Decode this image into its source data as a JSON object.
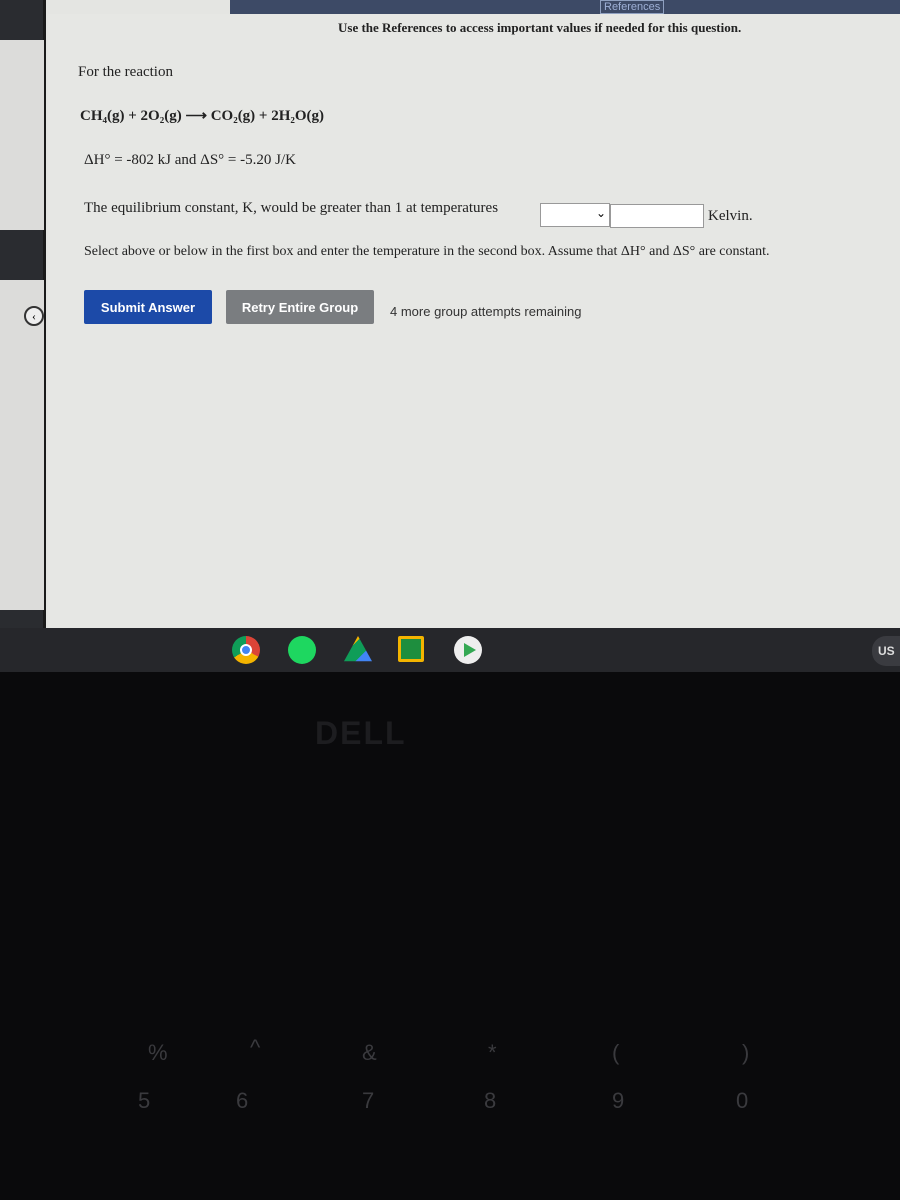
{
  "header": {
    "references_link": "References",
    "hint": "Use the References to access important values if needed for this question."
  },
  "question": {
    "intro": "For the reaction",
    "reaction": "CH₄(g) + 2O₂(g) ⟶ CO₂(g) + 2H₂O(g)",
    "thermo": "ΔH° = -802 kJ and ΔS° = -5.20 J/K",
    "prompt": "The equilibrium constant, K, would be greater than 1 at temperatures",
    "select_value": "",
    "temperature_value": "",
    "unit": "Kelvin.",
    "instructions": "Select above or below in the first box and enter the temperature in the second box. Assume that ΔH° and ΔS° are constant."
  },
  "actions": {
    "submit": "Submit Answer",
    "retry": "Retry Entire Group",
    "attempts": "4 more group attempts remaining"
  },
  "shelf": {
    "apps": [
      "chrome-icon",
      "spotify-icon",
      "drive-icon",
      "classroom-icon",
      "play-store-icon"
    ],
    "input_method": "US"
  },
  "keyboard": {
    "brand": "DELL",
    "keys": [
      "%",
      "5",
      "^",
      "6",
      "&",
      "7",
      "*",
      "8",
      "(",
      "9",
      ")",
      "0"
    ]
  }
}
